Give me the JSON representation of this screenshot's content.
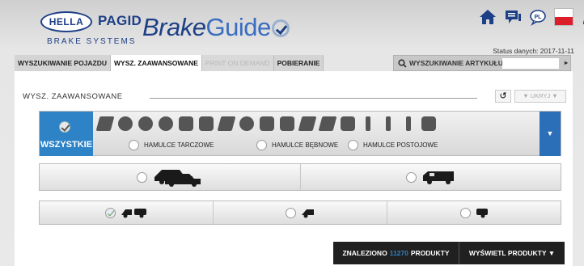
{
  "brand": {
    "hella": "HELLA",
    "pagid": "PAGID",
    "systems": "BRAKE SYSTEMS",
    "brake": "Brake",
    "guide": "Guide"
  },
  "header": {
    "language": "PL",
    "status_label": "Status danych: 2017-11-11"
  },
  "tabs": [
    {
      "label": "WYSZUKIWANIE POJAZDU"
    },
    {
      "label": "WYSZ. ZAAWANSOWANE"
    },
    {
      "label": "PRINT ON DEMAND"
    },
    {
      "label": "POBIERANIE"
    }
  ],
  "article_search": {
    "label": "WYSZUKIWANIE ARTYKUŁU",
    "value": ""
  },
  "section": {
    "title": "WYSZ. ZAAWANSOWANE",
    "hide_label": "▼ UKRYJ ▼"
  },
  "categories": {
    "all_label": "WSZYSTKIE",
    "sub": [
      "HAMULCE TARCZOWE",
      "HAMULCE BĘBNOWE",
      "HAMULCE POSTOJOWE"
    ]
  },
  "result": {
    "prefix": "ZNALEZIONO",
    "count": "11270",
    "suffix": "PRODUKTY",
    "show_label": "WYŚWIETL PRODUKTY ▼"
  },
  "colors": {
    "accent": "#2e83c7",
    "brand": "#1d3f86"
  }
}
